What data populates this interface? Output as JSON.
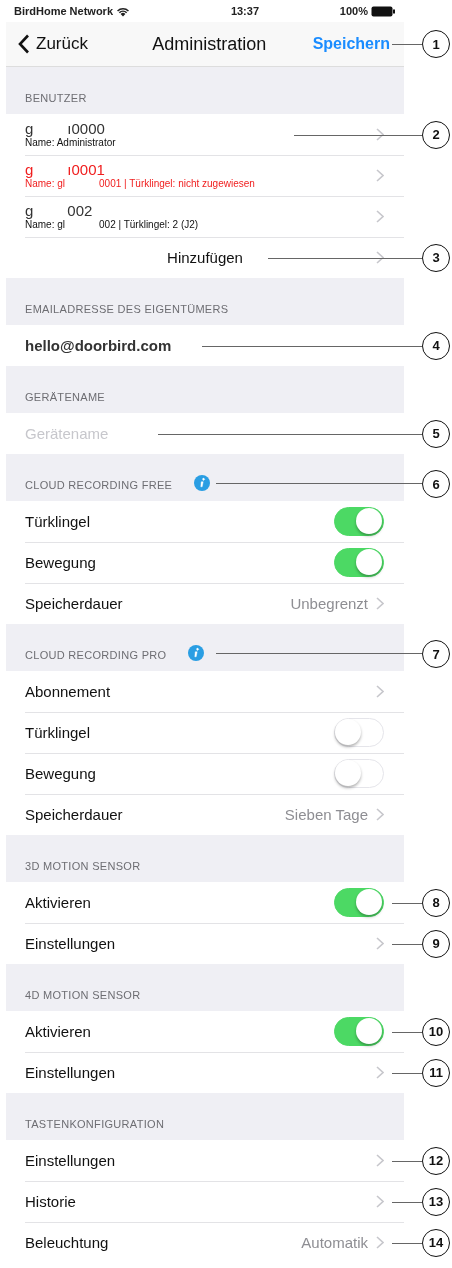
{
  "status_bar": {
    "carrier": "BirdHome Network",
    "time": "13:37",
    "battery": "100%"
  },
  "nav": {
    "back": "Zurück",
    "title": "Administration",
    "action": "Speichern",
    "callout": "1"
  },
  "sections": [
    {
      "title": "BENUTZER",
      "rows": [
        {
          "kind": "user",
          "alert": false,
          "id_parts": [
            "g",
            "ı0000"
          ],
          "detail_parts": [
            "Name: Administrator"
          ],
          "callout": "2"
        },
        {
          "kind": "user",
          "alert": true,
          "id_parts": [
            "g",
            "ı0001"
          ],
          "detail_parts": [
            "Name: gl",
            "0001 | Türklingel: nicht zugewiesen"
          ]
        },
        {
          "kind": "user",
          "alert": false,
          "id_parts": [
            "g",
            "002"
          ],
          "detail_parts": [
            "Name: gl",
            "002 | Türklingel: 2 (J2)"
          ]
        },
        {
          "kind": "action",
          "label": "Hinzufügen",
          "callout": "3"
        }
      ]
    },
    {
      "title": "EMAILADRESSE DES EIGENTÜMERS",
      "rows": [
        {
          "kind": "email",
          "value": "hello@doorbird.com",
          "callout": "4"
        }
      ]
    },
    {
      "title": "GERÄTENAME",
      "rows": [
        {
          "kind": "field",
          "placeholder": "Gerätename",
          "callout": "5"
        }
      ]
    },
    {
      "title": "CLOUD RECORDING FREE",
      "info": true,
      "callout": "6",
      "rows": [
        {
          "kind": "toggle",
          "label": "Türklingel",
          "on": true
        },
        {
          "kind": "toggle",
          "label": "Bewegung",
          "on": true
        },
        {
          "kind": "link",
          "label": "Speicherdauer",
          "value": "Unbegrenzt"
        }
      ]
    },
    {
      "title": "CLOUD RECORDING PRO",
      "info": true,
      "callout": "7",
      "rows": [
        {
          "kind": "link",
          "label": "Abonnement"
        },
        {
          "kind": "toggle",
          "label": "Türklingel",
          "on": false
        },
        {
          "kind": "toggle",
          "label": "Bewegung",
          "on": false
        },
        {
          "kind": "link",
          "label": "Speicherdauer",
          "value": "Sieben Tage"
        }
      ]
    },
    {
      "title": "3D MOTION SENSOR",
      "rows": [
        {
          "kind": "toggle",
          "label": "Aktivieren",
          "on": true,
          "callout": "8"
        },
        {
          "kind": "link",
          "label": "Einstellungen",
          "callout": "9"
        }
      ]
    },
    {
      "title": "4D MOTION SENSOR",
      "rows": [
        {
          "kind": "toggle",
          "label": "Aktivieren",
          "on": true,
          "callout": "10"
        },
        {
          "kind": "link",
          "label": "Einstellungen",
          "callout": "11"
        }
      ]
    },
    {
      "title": "TASTENKONFIGURATION",
      "rows": [
        {
          "kind": "link",
          "label": "Einstellungen",
          "callout": "12"
        },
        {
          "kind": "link",
          "label": "Historie",
          "callout": "13"
        },
        {
          "kind": "link",
          "label": "Beleuchtung",
          "value": "Automatik",
          "callout": "14"
        }
      ]
    }
  ]
}
